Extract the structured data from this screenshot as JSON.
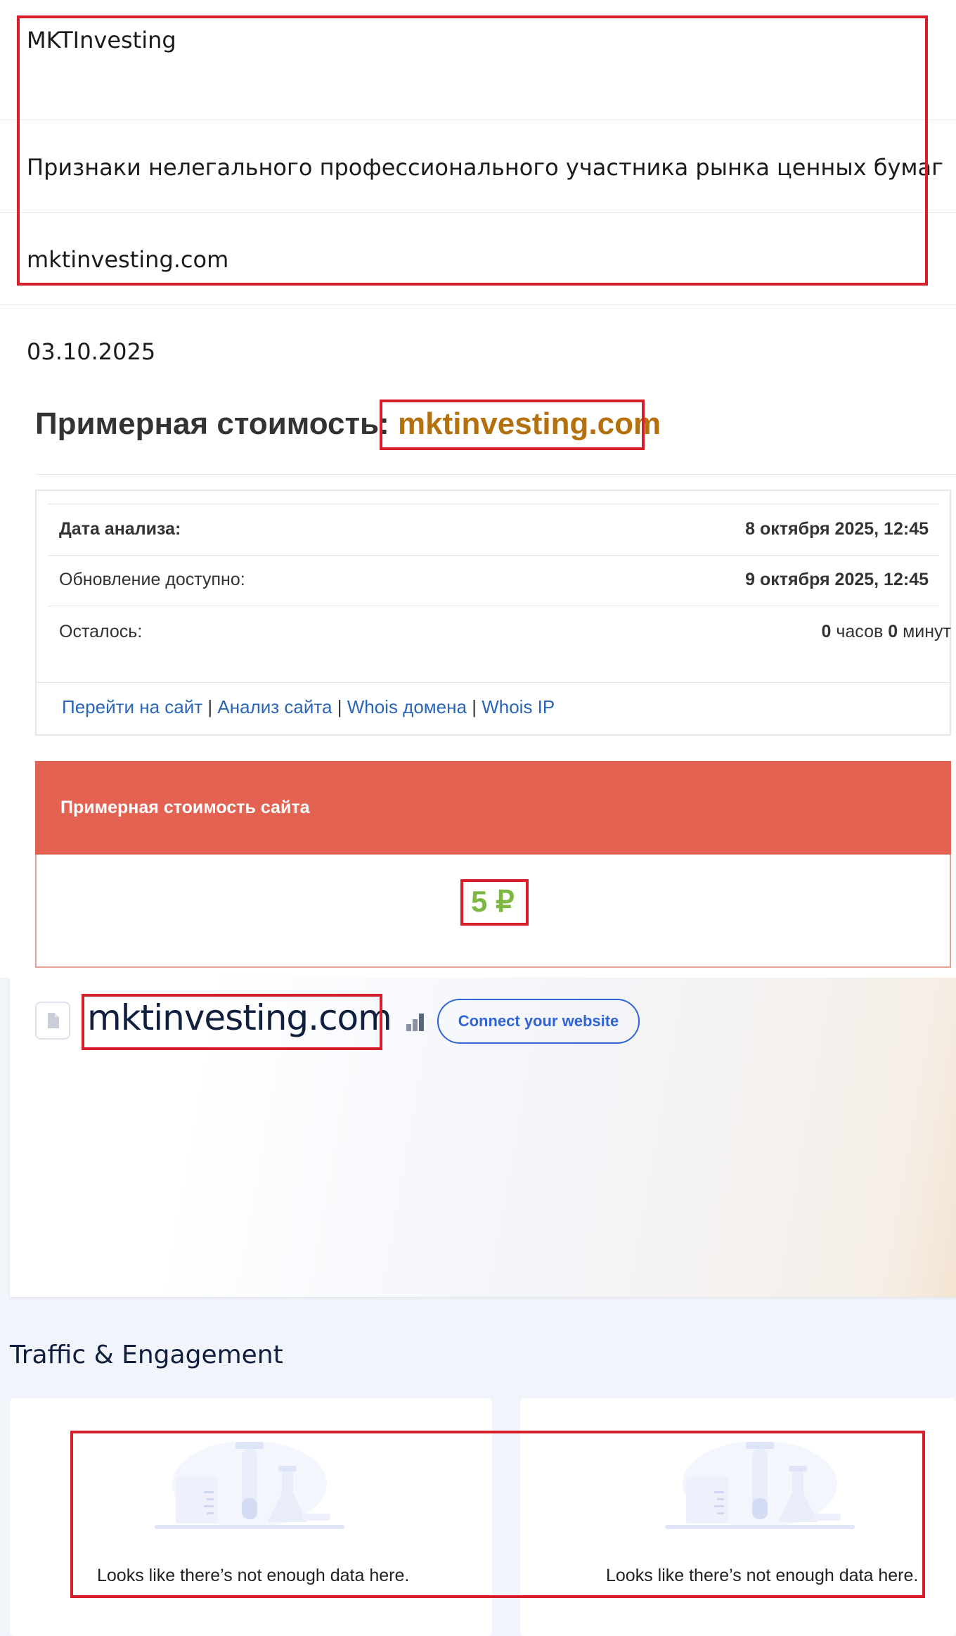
{
  "info": {
    "name": "MKTInvesting",
    "category": "Признаки нелегального профессионального участника рынка ценных бумаг",
    "domain": "mktinvesting.com",
    "date": "03.10.2025"
  },
  "estimate": {
    "title_prefix": "Примерная стоимость:",
    "domain": "mktinvesting.com",
    "rows": [
      {
        "label": "Дата анализа:",
        "value": "8 октября 2025, 12:45"
      },
      {
        "label": "Обновление доступно:",
        "value": "9 октября 2025, 12:45"
      }
    ],
    "remaining": {
      "label": "Осталось:",
      "hours": "0",
      "hours_unit": "часов",
      "minutes": "0",
      "minutes_unit": "минут"
    },
    "links": {
      "visit": "Перейти на сайт",
      "analysis": "Анализ сайта",
      "whois_domain": "Whois домена",
      "whois_ip": "Whois IP",
      "separator": "|"
    },
    "value_header": "Примерная стоимость сайта",
    "value": "5 ₽",
    "colors": {
      "header": "#e36252",
      "value": "#7db843",
      "domain": "#b5700e"
    }
  },
  "similarweb": {
    "domain": "mktinvesting.com",
    "connect_button": "Connect your website",
    "section_title": "Traffic & Engagement",
    "cards": [
      {
        "message": "Looks like there’s not enough data here."
      },
      {
        "message": "Looks like there’s not enough data here."
      }
    ],
    "colors": {
      "button": "#2f63d6",
      "title": "#0f1f3d"
    }
  },
  "highlight_color": "#d71f2b"
}
